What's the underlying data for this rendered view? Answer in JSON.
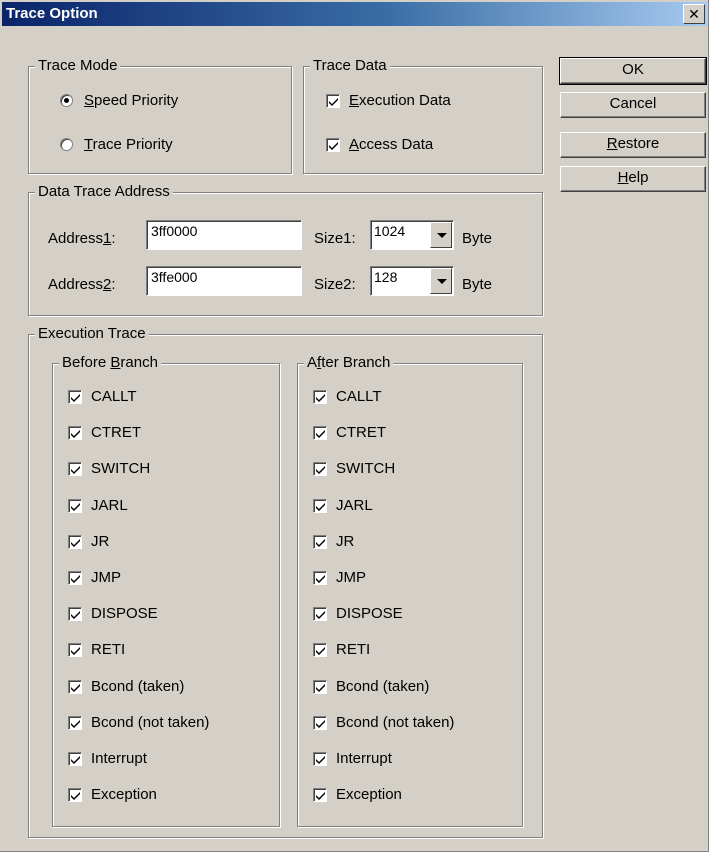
{
  "window": {
    "title": "Trace Option",
    "close_glyph": "✕"
  },
  "trace_mode": {
    "legend": "Trace Mode",
    "speed_priority": {
      "pre": "",
      "acc": "S",
      "post": "peed Priority",
      "selected": true
    },
    "trace_priority": {
      "pre": "",
      "acc": "T",
      "post": "race Priority",
      "selected": false
    }
  },
  "trace_data": {
    "legend": "Trace Data",
    "execution_data": {
      "pre": "",
      "acc": "E",
      "post": "xecution Data",
      "checked": true
    },
    "access_data": {
      "pre": "",
      "acc": "A",
      "post": "ccess Data",
      "checked": true
    }
  },
  "buttons": {
    "ok": "OK",
    "cancel": "Cancel",
    "restore": {
      "pre": "",
      "acc": "R",
      "post": "estore"
    },
    "help": {
      "pre": "",
      "acc": "H",
      "post": "elp"
    }
  },
  "data_trace_address": {
    "legend": "Data Trace Address",
    "address1": {
      "pre": "Address",
      "acc": "1",
      "post": ":",
      "value": "3ff0000"
    },
    "address2": {
      "pre": "Address",
      "acc": "2",
      "post": ":",
      "value": "3ffe000"
    },
    "size1": {
      "label": "Size1:",
      "value": "1024",
      "unit": "Byte"
    },
    "size2": {
      "label": "Size2:",
      "value": "128",
      "unit": "Byte"
    }
  },
  "execution_trace": {
    "legend": "Execution Trace",
    "before_branch": {
      "pre": "Before ",
      "acc": "B",
      "post": "ranch"
    },
    "after_branch": {
      "pre": "A",
      "acc": "f",
      "post": "ter Branch"
    },
    "items": [
      {
        "label": "CALLT",
        "before": true,
        "after": true
      },
      {
        "label": "CTRET",
        "before": true,
        "after": true
      },
      {
        "label": "SWITCH",
        "before": true,
        "after": true
      },
      {
        "label": "JARL",
        "before": true,
        "after": true
      },
      {
        "label": "JR",
        "before": true,
        "after": true
      },
      {
        "label": "JMP",
        "before": true,
        "after": true
      },
      {
        "label": "DISPOSE",
        "before": true,
        "after": true
      },
      {
        "label": "RETI",
        "before": true,
        "after": true
      },
      {
        "label": "Bcond (taken)",
        "before": true,
        "after": true
      },
      {
        "label": "Bcond (not taken)",
        "before": true,
        "after": true
      },
      {
        "label": "Interrupt",
        "before": true,
        "after": true
      },
      {
        "label": "Exception",
        "before": true,
        "after": true
      }
    ]
  }
}
